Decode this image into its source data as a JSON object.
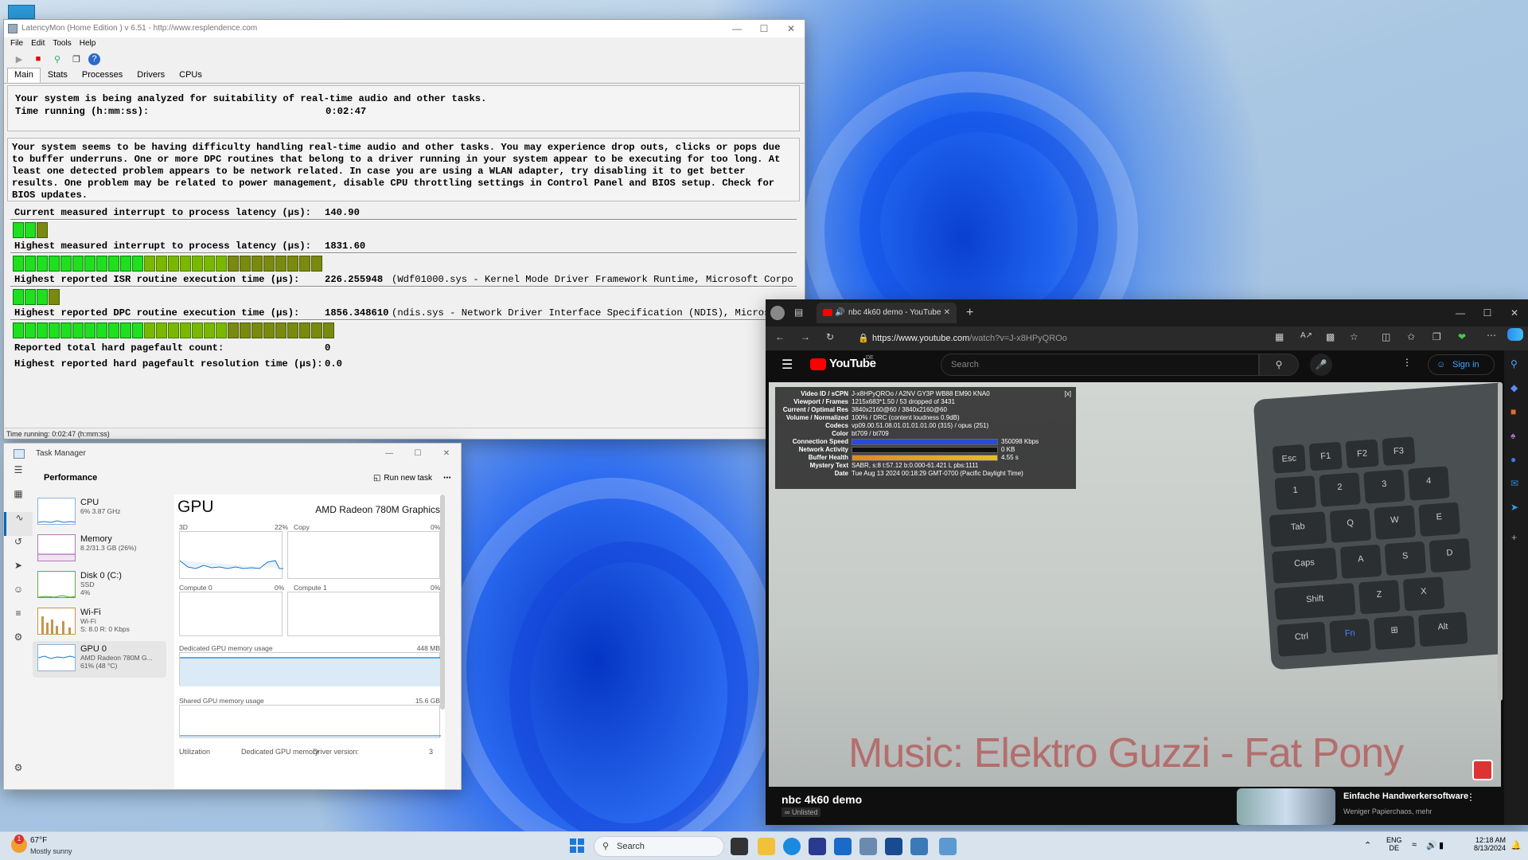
{
  "latencymon": {
    "title": "LatencyMon  (Home Edition )  v 6.51 - http://www.resplendence.com",
    "menu": [
      "File",
      "Edit",
      "Tools",
      "Help"
    ],
    "tabs": [
      "Main",
      "Stats",
      "Processes",
      "Drivers",
      "CPUs"
    ],
    "analyzing": "Your system is being analyzed for suitability of real-time audio and other tasks.",
    "time_label": "Time running (h:mm:ss):",
    "time_value": "0:02:47",
    "warning": "Your system seems to be having difficulty handling real-time audio and other tasks. You may experience drop outs, clicks or pops due to buffer underruns. One or more DPC routines that belong to a driver running in your system appear to be executing for too long. At least one detected problem appears to be network related. In case you are using a WLAN adapter, try disabling it to get better results. One problem may be related to power management, disable CPU throttling settings in Control Panel and BIOS setup. Check for BIOS updates.",
    "metrics": [
      {
        "label": "Current measured interrupt to process latency (µs):",
        "value": "140.90",
        "extra": "",
        "level": 0.045
      },
      {
        "label": "Highest measured interrupt to process latency (µs):",
        "value": "1831.60",
        "extra": "",
        "level": 0.41
      },
      {
        "label": "Highest reported ISR routine execution time (µs):",
        "value": "226.255948",
        "extra": "(Wdf01000.sys - Kernel Mode Driver Framework Runtime, Microsoft Corpo",
        "level": 0.065
      },
      {
        "label": "Highest reported DPC routine execution time (µs):",
        "value": "1856.348610",
        "extra": "(ndis.sys - Network Driver Interface Specification (NDIS), Microsoft",
        "level": 0.415
      }
    ],
    "pagefault_count_label": "Reported total hard pagefault count:",
    "pagefault_count": "0",
    "pagefault_time_label": "Highest reported hard pagefault resolution time (µs):",
    "pagefault_time": "0.0",
    "status": "Time running: 0:02:47  (h:mm:ss)"
  },
  "taskmanager": {
    "title": "Task Manager",
    "section": "Performance",
    "run_task": "Run new task",
    "items": [
      {
        "name": "CPU",
        "sub": "6% 3.87 GHz",
        "sub2": ""
      },
      {
        "name": "Memory",
        "sub": "8.2/31.3 GB (26%)",
        "sub2": ""
      },
      {
        "name": "Disk 0 (C:)",
        "sub": "SSD",
        "sub2": "4%"
      },
      {
        "name": "Wi-Fi",
        "sub": "Wi-Fi",
        "sub2": "S: 8.0  R: 0 Kbps"
      },
      {
        "name": "GPU 0",
        "sub": "AMD Radeon 780M G...",
        "sub2": "61% (48 °C)"
      }
    ],
    "gpu_title": "GPU",
    "gpu_name": "AMD Radeon 780M Graphics",
    "graphs": {
      "g3d": "3D",
      "g3d_pct": "22%",
      "copy": "Copy",
      "copy_pct": "0%",
      "c0": "Compute 0",
      "c0_pct": "0%",
      "c1": "Compute 1",
      "c1_pct": "0%"
    },
    "dedicated_label": "Dedicated GPU memory usage",
    "dedicated_max": "448 MB",
    "shared_label": "Shared GPU memory usage",
    "shared_max": "15.6 GB",
    "footer": {
      "util": "Utilization",
      "ded": "Dedicated GPU memory",
      "drv": "Driver version:",
      "drv_val": "3"
    }
  },
  "edge": {
    "tab_title": "nbc 4k60 demo - YouTube",
    "url_host": "https://www.youtube.com",
    "url_path": "/watch?v=J-x8HPyQROo",
    "yt_logo": "YouTube",
    "yt_region": "DE",
    "search_placeholder": "Search",
    "signin": "Sign in",
    "stats": [
      [
        "Video ID / sCPN",
        "J-x8HPyQROo  /  A2NV GY3P WB88 EM90 KNA0"
      ],
      [
        "Viewport / Frames",
        "1215x683*1.50 / 53 dropped of 3431"
      ],
      [
        "Current / Optimal Res",
        "3840x2160@60 / 3840x2160@60"
      ],
      [
        "Volume / Normalized",
        "100% / DRC (content loudness 0.9dB)"
      ],
      [
        "Codecs",
        "vp09.00.51.08.01.01.01.01.00 (315) / opus (251)"
      ],
      [
        "Color",
        "bt709 / bt709"
      ],
      [
        "Connection Speed",
        "350098 Kbps"
      ],
      [
        "Network Activity",
        "0 KB"
      ],
      [
        "Buffer Health",
        "4.55 s"
      ],
      [
        "Mystery Text",
        "SABR, s:8 t:57.12 b:0.000-61.421 L pbs:1111"
      ],
      [
        "Date",
        "Tue Aug 13 2024 00:18:29 GMT-0700 (Pacific Daylight Time)"
      ]
    ],
    "stats_close": "[x]",
    "music_overlay": "Music: Elektro Guzzi - Fat Pony",
    "video_title": "nbc 4k60 demo",
    "unlisted": "Unlisted",
    "rec_title": "Einfache Handwerkersoftware",
    "rec_sub": "Weniger Papierchaos, mehr"
  },
  "taskbar": {
    "weather_temp": "67°F",
    "weather_text": "Mostly sunny",
    "search": "Search",
    "lang1": "ENG",
    "lang2": "DE",
    "time": "12:18 AM",
    "date": "8/13/2024",
    "weather_badge": "1"
  }
}
